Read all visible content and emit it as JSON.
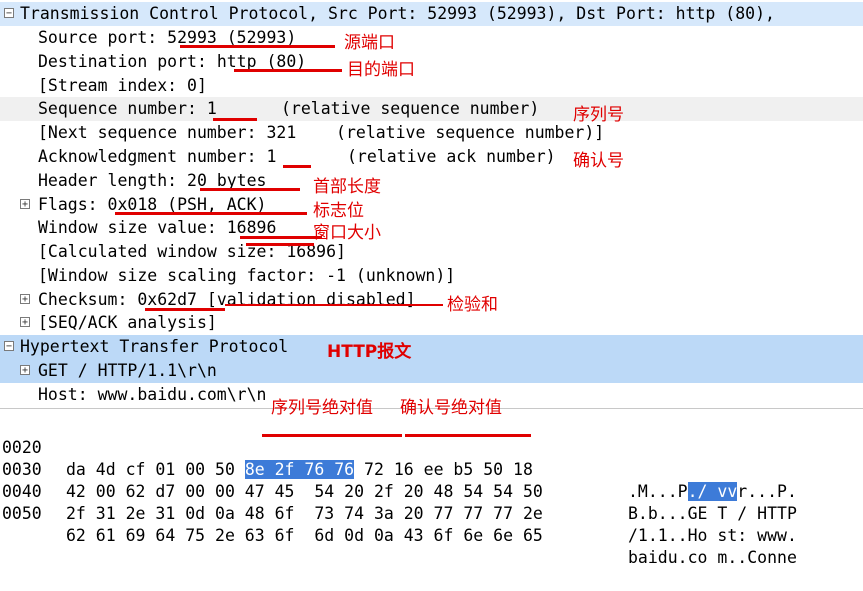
{
  "tree": {
    "tcp_header": "Transmission Control Protocol, Src Port: 52993 (52993), Dst Port: http (80),",
    "src_port_label": "Source port: ",
    "src_port_value": "52993 (52993)",
    "dst_port_label": "Destination port: ",
    "dst_port_value": "http (80)",
    "stream_index": "[Stream index: 0]",
    "seq_label": "Sequence number: ",
    "seq_value": "1",
    "seq_note": "(relative sequence number)",
    "next_seq": "[Next sequence number: 321    (relative sequence number)]",
    "ack_label": "Acknowledgment number: ",
    "ack_value": "1",
    "ack_note": "(relative ack number)",
    "hdr_len_label": "Header length: ",
    "hdr_len_value": "20 bytes",
    "flags_label": "Flags: ",
    "flags_value": "0x018 (PSH, ACK)",
    "win_label": "Window size value: ",
    "win_value": "16896",
    "calc_win": "[Calculated window size: 16896]",
    "win_scale": "[Window size scaling factor: -1 (unknown)]",
    "checksum_label": "Checksum: ",
    "checksum_value": "0x62d7",
    "checksum_note": " [validation disabled]",
    "seqack": "[SEQ/ACK analysis]",
    "http_header": "Hypertext Transfer Protocol",
    "http_get": "GET / HTTP/1.1\\r\\n",
    "http_host": "Host: www.baidu.com\\r\\n"
  },
  "annotations": {
    "src_port": "源端口",
    "dst_port": "目的端口",
    "seq": "序列号",
    "ack": "确认号",
    "hdr_len": "首部长度",
    "flags": "标志位",
    "window": "窗口大小",
    "checksum": "检验和",
    "http": "HTTP报文",
    "seq_abs": "序列号绝对值",
    "ack_abs": "确认号绝对值"
  },
  "hex": {
    "r0_off": "0020",
    "r0_a": "da 4d cf 01 00 50 ",
    "r0_b": "8e 2f 76 76",
    "r0_c": " 72 16 ee b5 50 18",
    "r0_asc_a": ".M...P",
    "r0_asc_b": "./ vv",
    "r0_asc_c": "r...P.",
    "r1_off": "0030",
    "r1_hex": "42 00 62 d7 00 00 47 45  54 20 2f 20 48 54 54 50",
    "r1_asc": "B.b...GE T / HTTP",
    "r2_off": "0040",
    "r2_hex": "2f 31 2e 31 0d 0a 48 6f  73 74 3a 20 77 77 77 2e",
    "r2_asc": "/1.1..Ho st: www.",
    "r3_off": "0050",
    "r3_hex": "62 61 69 64 75 2e 63 6f  6d 0d 0a 43 6f 6e 6e 65",
    "r3_asc": "baidu.co m..Conne"
  }
}
